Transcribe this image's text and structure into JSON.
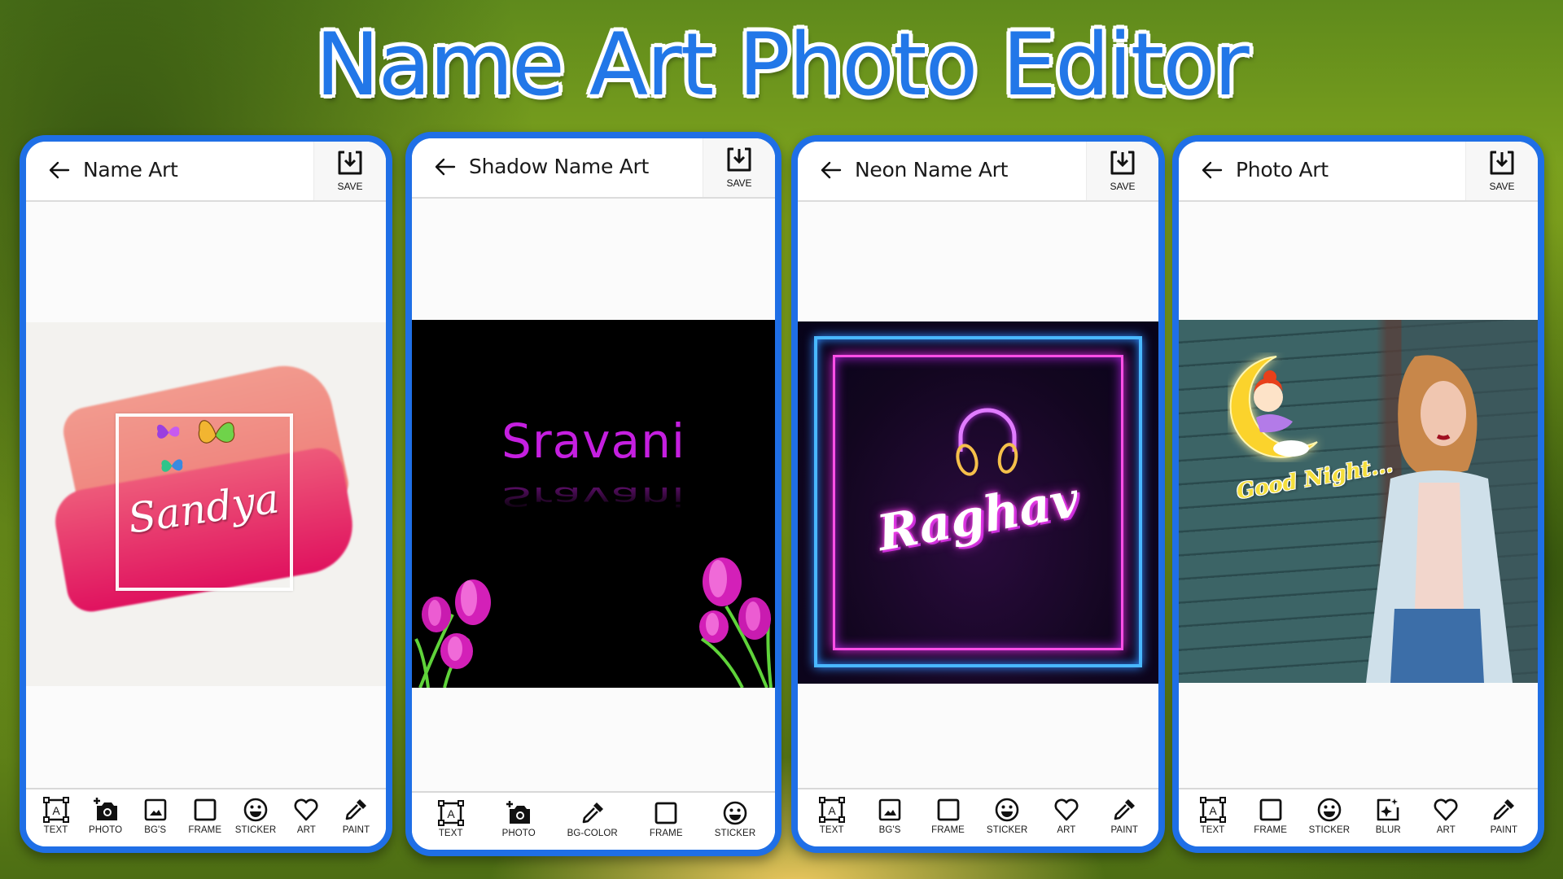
{
  "banner": {
    "title": "Name Art Photo Editor",
    "title_color": "#2277e8",
    "frame_color": "#1f6fe6"
  },
  "panels": [
    {
      "title": "Name Art",
      "save_label": "SAVE",
      "art": {
        "name_text": "Sandya",
        "style": "watercolor brush with butterflies"
      },
      "toolbar": [
        {
          "label": "TEXT",
          "icon": "text-box-icon"
        },
        {
          "label": "PHOTO",
          "icon": "add-photo-icon"
        },
        {
          "label": "BG'S",
          "icon": "image-icon"
        },
        {
          "label": "FRAME",
          "icon": "frame-icon"
        },
        {
          "label": "STICKER",
          "icon": "smiley-icon"
        },
        {
          "label": "ART",
          "icon": "heart-icon"
        },
        {
          "label": "PAINT",
          "icon": "eyedropper-icon"
        }
      ]
    },
    {
      "title": "Shadow Name Art",
      "save_label": "SAVE",
      "art": {
        "name_text": "Sravani",
        "style": "purple text with reflection, pink flowers"
      },
      "toolbar": [
        {
          "label": "TEXT",
          "icon": "text-box-icon"
        },
        {
          "label": "PHOTO",
          "icon": "add-photo-icon"
        },
        {
          "label": "BG-COLOR",
          "icon": "eyedropper-icon"
        },
        {
          "label": "FRAME",
          "icon": "frame-icon"
        },
        {
          "label": "STICKER",
          "icon": "smiley-icon"
        }
      ]
    },
    {
      "title": "Neon Name Art",
      "save_label": "SAVE",
      "art": {
        "name_text": "Raghav",
        "style": "neon frame with headphones"
      },
      "toolbar": [
        {
          "label": "TEXT",
          "icon": "text-box-icon"
        },
        {
          "label": "BG'S",
          "icon": "image-icon"
        },
        {
          "label": "FRAME",
          "icon": "frame-icon"
        },
        {
          "label": "STICKER",
          "icon": "smiley-icon"
        },
        {
          "label": "ART",
          "icon": "heart-icon"
        },
        {
          "label": "PAINT",
          "icon": "eyedropper-icon"
        }
      ]
    },
    {
      "title": "Photo Art",
      "save_label": "SAVE",
      "art": {
        "sticker_text": "Good Night...",
        "style": "photo with moon sticker"
      },
      "toolbar": [
        {
          "label": "TEXT",
          "icon": "text-box-icon"
        },
        {
          "label": "FRAME",
          "icon": "frame-icon"
        },
        {
          "label": "STICKER",
          "icon": "smiley-icon"
        },
        {
          "label": "BLUR",
          "icon": "blur-sparkle-icon"
        },
        {
          "label": "ART",
          "icon": "heart-icon"
        },
        {
          "label": "PAINT",
          "icon": "eyedropper-icon"
        }
      ]
    }
  ]
}
